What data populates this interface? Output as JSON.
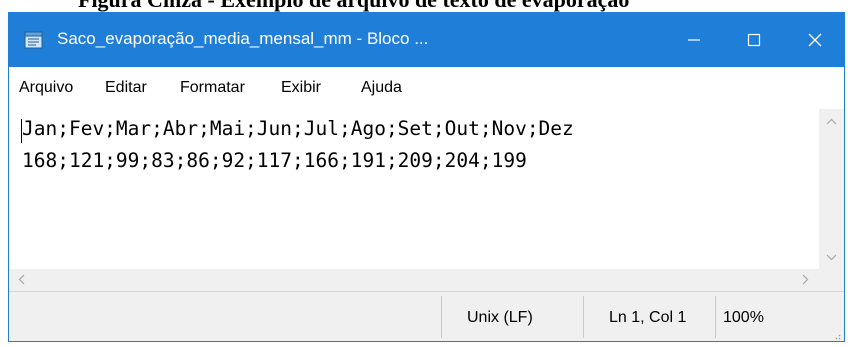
{
  "caption": "Figura Cinza - Exemplo de arquivo de texto de evaporação",
  "window": {
    "title": "Saco_evaporação_media_mensal_mm - Bloco ...",
    "app_icon": "notepad-icon",
    "controls": [
      "minimize-icon",
      "maximize-icon",
      "close-icon"
    ]
  },
  "menu": [
    "Arquivo",
    "Editar",
    "Formatar",
    "Exibir",
    "Ajuda"
  ],
  "editor": {
    "lines": [
      "Jan;Fev;Mar;Abr;Mai;Jun;Jul;Ago;Set;Out;Nov;Dez",
      "168;121;99;83;86;92;117;166;191;209;204;199"
    ]
  },
  "statusbar": {
    "line_ending": "Unix (LF)",
    "position": "Ln 1, Col 1",
    "zoom": "100%"
  },
  "colors": {
    "titlebar": "#1f7fd8",
    "title_text": "#ffffff",
    "chrome": "#f0f0f0"
  }
}
